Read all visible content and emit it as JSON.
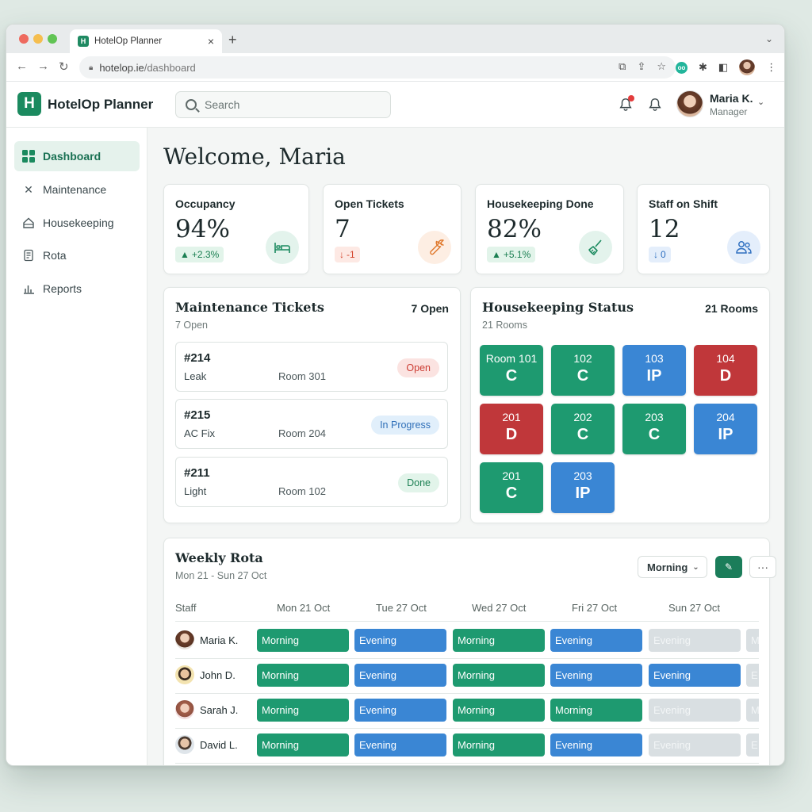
{
  "browser": {
    "tab_title": "HotelOp Planner",
    "tab_favicon": "H",
    "tab_close": "×",
    "new_tab": "+",
    "url_host": "hotelop.ie",
    "url_path": "/dashboard",
    "traffic_lights": [
      "#ee6a5f",
      "#f5be4f",
      "#61c454"
    ]
  },
  "header": {
    "logo_letter": "H",
    "app_name": "HotelOp Planner",
    "search_placeholder": "Search",
    "user_name": "Maria K.",
    "user_role": "Manager"
  },
  "sidebar": {
    "items": [
      {
        "label": "Dashboard",
        "icon": "dashboard-grid-icon",
        "active": true
      },
      {
        "label": "Maintenance",
        "icon": "wrench-icon",
        "active": false
      },
      {
        "label": "Housekeeping",
        "icon": "house-icon",
        "active": false
      },
      {
        "label": "Rota",
        "icon": "document-icon",
        "active": false
      },
      {
        "label": "Reports",
        "icon": "bar-chart-icon",
        "active": false
      }
    ]
  },
  "main": {
    "welcome": "Welcome, Maria",
    "stats": [
      {
        "label": "Occupancy",
        "value": "94%",
        "delta": "+2.3%",
        "trend": "up",
        "icon": "bed-icon"
      },
      {
        "label": "Open Tickets",
        "value": "7",
        "delta": "-1",
        "trend": "down",
        "icon": "wrench-icon"
      },
      {
        "label": "Housekeeping Done",
        "value": "82%",
        "delta": "+5.1%",
        "trend": "up",
        "icon": "broom-icon"
      },
      {
        "label": "Staff on Shift",
        "value": "12",
        "delta": "0",
        "trend": "neutral",
        "icon": "people-icon"
      }
    ],
    "maintenance": {
      "title": "Maintenance Tickets",
      "subtitle": "7 Open",
      "count": "7 Open",
      "tickets": [
        {
          "id": "#214",
          "desc": "Leak",
          "room": "Room 301",
          "status": "Open"
        },
        {
          "id": "#215",
          "desc": "AC Fix",
          "room": "Room 204",
          "status": "In Progress"
        },
        {
          "id": "#211",
          "desc": "Light",
          "room": "Room 102",
          "status": "Done"
        }
      ]
    },
    "housekeeping": {
      "title": "Housekeeping Status",
      "subtitle": "21 Rooms",
      "count": "21 Rooms",
      "rooms": [
        {
          "name": "Room 101",
          "status": "C"
        },
        {
          "name": "102",
          "status": "C"
        },
        {
          "name": "103",
          "status": "IP"
        },
        {
          "name": "104",
          "status": "D"
        },
        {
          "name": "201",
          "status": "D"
        },
        {
          "name": "202",
          "status": "C"
        },
        {
          "name": "203",
          "status": "C"
        },
        {
          "name": "204",
          "status": "IP"
        },
        {
          "name": "201",
          "status": "C"
        },
        {
          "name": "203",
          "status": "IP"
        }
      ]
    },
    "rota": {
      "title": "Weekly Rota",
      "subtitle": "Mon 21 - Sun 27 Oct",
      "shift_filter": "Morning",
      "more": "···",
      "columns": [
        "Staff",
        "Mon 21 Oct",
        "Tue 27 Oct",
        "Wed 27 Oct",
        "Fri 27 Oct",
        "Sun 27 Oct"
      ],
      "rows": [
        {
          "name": "Maria K.",
          "shifts": [
            "Morning",
            "Evening",
            "Morning",
            "Evening",
            "Evening",
            "M"
          ],
          "off": [
            false,
            false,
            false,
            false,
            true,
            true
          ]
        },
        {
          "name": "John D.",
          "shifts": [
            "Morning",
            "Evening",
            "Morning",
            "Evening",
            "Evening",
            "E"
          ],
          "off": [
            false,
            false,
            false,
            false,
            false,
            true
          ]
        },
        {
          "name": "Sarah J.",
          "shifts": [
            "Morning",
            "Evening",
            "Morning",
            "Morning",
            "Evening",
            "M"
          ],
          "off": [
            false,
            false,
            false,
            false,
            true,
            true
          ]
        },
        {
          "name": "David L.",
          "shifts": [
            "Morning",
            "Evening",
            "Morning",
            "Evening",
            "Evening",
            "E"
          ],
          "off": [
            false,
            false,
            false,
            false,
            true,
            true
          ]
        }
      ]
    }
  },
  "colors": {
    "brand": "#1b8a5f",
    "room_clean": "#1e9a70",
    "room_in_progress": "#3a86d4",
    "room_dirty": "#c0373a"
  }
}
